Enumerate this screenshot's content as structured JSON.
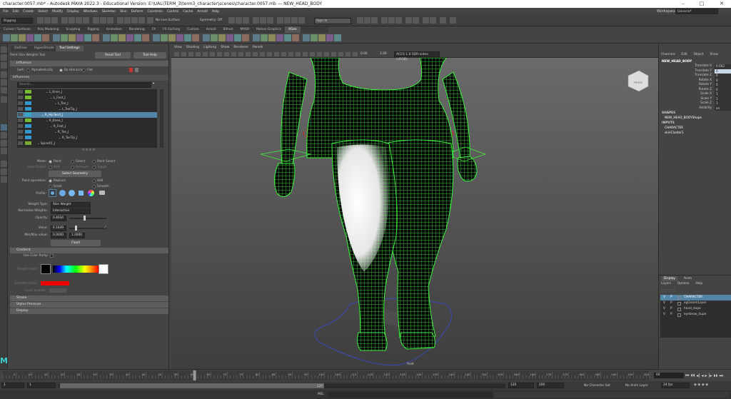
{
  "window": {
    "title": "character.0057.mb* - Autodesk MAYA 2022.3 - Educational Version: E:\\UAL\\TERM_3\\term3_character\\scenes\\character.0057.mb  ---  NEW_HEAD_BODY"
  },
  "menu": [
    "File",
    "Edit",
    "Create",
    "Select",
    "Modify",
    "Display",
    "Windows",
    "Skeleton",
    "Skin",
    "Deform",
    "Constrain",
    "Control",
    "Cache",
    "Arnold",
    "Help"
  ],
  "workspace": {
    "label": "Workspace:",
    "value": "General*"
  },
  "status": {
    "mode": "Rigging",
    "live_surface": "No Live Surface",
    "symmetry": "Symmetry: Off",
    "sign_in": "Sign In"
  },
  "shelf_tabs": [
    "Curves / Surfaces",
    "Poly Modeling",
    "Sculpting",
    "Rigging",
    "Animation",
    "Rendering",
    "FX",
    "FX Caching",
    "Custom",
    "Arnold",
    "Bifrost",
    "MASH",
    "Motion Graphics",
    "XGen"
  ],
  "shelf_active": "XGen",
  "left_panel": {
    "tabs": [
      "Outliner",
      "HyperShade",
      "Tool Settings"
    ],
    "tool_title": "Paint Skin Weights Tool",
    "reset_label": "Reset Tool",
    "help_label": "Tool Help",
    "influence_header": "Influence",
    "sort_label": "Sort:",
    "sort_options": [
      "Alphabetically",
      "By Hierarchy",
      "Flat"
    ],
    "influences_label": "Influences",
    "search_placeholder": "Search...",
    "tree": [
      "L_Knee_J",
      "L_Foot_J",
      "L_Toe_J",
      "L_ToeTip_J",
      "R_HipTwist_J",
      "R_Knee_J",
      "R_Foot_J",
      "R_Toe_J",
      "R_ToeTip_J",
      "Spine01_J"
    ],
    "selected_index": 4,
    "mode_label": "Mode:",
    "modes": [
      "Paint",
      "Select",
      "Paint Select"
    ],
    "paint_select_label": "Paint Select:",
    "paint_select_opts": [
      "Add",
      "Remove",
      "Toggle"
    ],
    "select_geometry": "Select Geometry",
    "paint_op_label": "Paint operation:",
    "paint_ops": [
      "Replace",
      "Add",
      "Scale",
      "Smooth"
    ],
    "profile_label": "Profile:",
    "weight_type_label": "Weight Type:",
    "weight_type": "Skin Weight",
    "normalize_label": "Normalize Weights:",
    "normalize": "Interactive",
    "opacity_label": "Opacity:",
    "opacity": "0.4034",
    "value_label": "Value:",
    "value": "0.1649",
    "minmax_label": "Min/Max value:",
    "min": "0.0000",
    "max": "1.0000",
    "flood_label": "Flood",
    "gradient_header": "Gradient",
    "use_color_ramp": "Use Color Ramp",
    "weight_color_label": "Weight Color:",
    "selected_color_label": "Selected Color:",
    "color_presets_label": "Color presets:",
    "collapsed_sections": [
      "Stroke",
      "Stylus Pressure",
      "Display"
    ]
  },
  "viewport": {
    "menu": [
      "View",
      "Shading",
      "Lighting",
      "Show",
      "Renderer",
      "Panels"
    ],
    "exposure": "0.00",
    "gamma": "1.00",
    "colorspace": "ACES 1.0 SDR-video (sRGB)",
    "cam_label": "FRONT",
    "bottom_label": "front"
  },
  "channel_box": {
    "menu": [
      "Channels",
      "Edit",
      "Object",
      "Show"
    ],
    "object": "NEW_HEAD_BODY",
    "channels": [
      {
        "name": "Translate X",
        "value": "0.002"
      },
      {
        "name": "Translate Y",
        "value": "0"
      },
      {
        "name": "Translate Z",
        "value": "0"
      },
      {
        "name": "Rotate X",
        "value": "0"
      },
      {
        "name": "Rotate Y",
        "value": "0"
      },
      {
        "name": "Rotate Z",
        "value": "0"
      },
      {
        "name": "Scale X",
        "value": "1"
      },
      {
        "name": "Scale Y",
        "value": "1"
      },
      {
        "name": "Scale Z",
        "value": "1"
      },
      {
        "name": "Visibility",
        "value": "on"
      }
    ],
    "shapes_label": "SHAPES",
    "shape_name": "NEW_HEAD_BODYShape",
    "inputs_label": "INPUTS",
    "inputs": [
      "CHARACTER",
      "skinCluster1"
    ]
  },
  "layer_editor": {
    "tabs": [
      "Display",
      "Anim"
    ],
    "menu": [
      "Layers",
      "Options",
      "Help"
    ],
    "layers": [
      {
        "name": "CHARACTER",
        "selected": true
      },
      {
        "name": "xgGroomLayer",
        "selected": false
      },
      {
        "name": "head_dupe",
        "selected": false
      },
      {
        "name": "eyebrow_dupe",
        "selected": false
      }
    ]
  },
  "timeline": {
    "ticks": [
      "5",
      "10",
      "15",
      "20",
      "25",
      "30",
      "35",
      "40",
      "45",
      "50",
      "55",
      "60",
      "65",
      "70",
      "75",
      "80",
      "85",
      "90",
      "95",
      "100",
      "105",
      "110",
      "115",
      "120",
      "125",
      "130",
      "135",
      "140",
      "145",
      "150",
      "155",
      "160",
      "165",
      "170",
      "175",
      "180",
      "185",
      "190",
      "195",
      "200"
    ],
    "current_frame": "60",
    "range_start": "1",
    "range_start2": "1",
    "range_inner": "120",
    "range_end": "120",
    "range_end2": "200",
    "no_character_set": "No Character Set",
    "no_anim_layer": "No Anim Layer",
    "fps": "24 fps"
  },
  "command_line": {
    "label": "MEL"
  },
  "colors": {
    "accent": "#5285a6",
    "mesh": "#33ff33",
    "paint": "#ffffff"
  }
}
